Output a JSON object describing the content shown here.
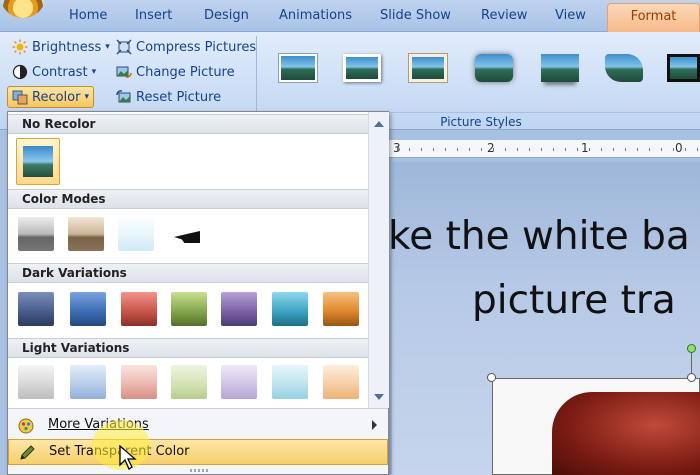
{
  "tabs": [
    "Home",
    "Insert",
    "Design",
    "Animations",
    "Slide Show",
    "Review",
    "View"
  ],
  "active_tab": "Format",
  "adjust_group": {
    "brightness": "Brightness",
    "contrast": "Contrast",
    "recolor": "Recolor",
    "compress": "Compress Pictures",
    "change": "Change Picture",
    "reset": "Reset Picture"
  },
  "picture_styles_label": "Picture Styles",
  "ruler_numbers": [
    "3",
    "2",
    "1",
    "0"
  ],
  "slide_text": [
    "ke the white ba",
    "picture tra"
  ],
  "dropdown": {
    "sections": [
      "No Recolor",
      "Color Modes",
      "Dark Variations",
      "Light Variations"
    ],
    "more_variations": "More Variations",
    "set_transparent": "Set Transparent Color"
  },
  "colors": {
    "accent_orange": "#f7b887",
    "selected_bg": "#f7cf6a",
    "ribbon_blue": "#15428b"
  },
  "icons": {
    "brightness": "sun-icon",
    "contrast": "contrast-icon",
    "recolor": "palette-icon",
    "compress": "compress-icon",
    "change": "change-picture-icon",
    "reset": "reset-picture-icon",
    "more_variations": "color-wheel-icon",
    "set_transparent": "pen-icon"
  }
}
